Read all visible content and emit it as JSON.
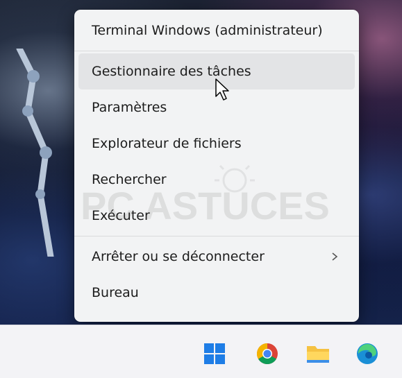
{
  "menu": {
    "items": [
      {
        "label": "Terminal Windows (administrateur)"
      },
      {
        "label": "Gestionnaire des tâches"
      },
      {
        "label": "Paramètres"
      },
      {
        "label": "Explorateur de fichiers"
      },
      {
        "label": "Rechercher"
      },
      {
        "label": "Exécuter"
      },
      {
        "label": "Arrêter ou se déconnecter",
        "submenu_icon": "chevron-right-icon"
      },
      {
        "label": "Bureau"
      }
    ],
    "hovered_index": 1
  },
  "watermark": {
    "text": "PC ASTUCES"
  },
  "taskbar": {
    "icons": [
      "windows-start-icon",
      "chrome-icon",
      "file-explorer-icon",
      "edge-icon"
    ]
  },
  "colors": {
    "menu_bg": "#f2f3f4",
    "hover_bg": "#e3e4e6",
    "taskbar_bg": "#f3f3f6"
  }
}
